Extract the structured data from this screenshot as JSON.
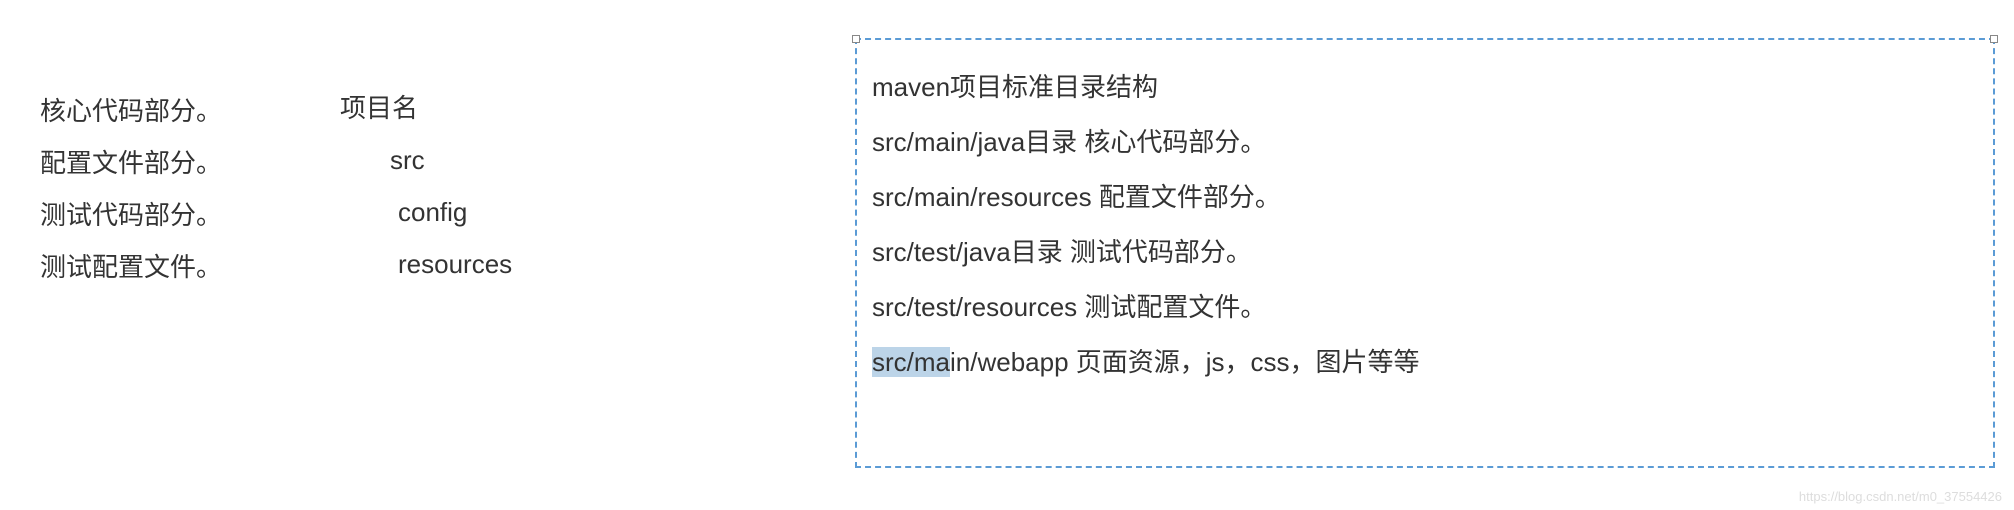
{
  "left_col1": {
    "line1": "核心代码部分。",
    "line2": "配置文件部分。",
    "line3": "测试代码部分。",
    "line4": "测试配置文件。"
  },
  "left_col2": {
    "line1": "项目名",
    "line2": "src",
    "line3": "config",
    "line4": "resources"
  },
  "right_box": {
    "line1": "maven项目标准目录结构",
    "line2": "src/main/java目录  核心代码部分。",
    "line3": "src/main/resources  配置文件部分。",
    "line4": "src/test/java目录 测试代码部分。",
    "line5": "src/test/resources 测试配置文件。",
    "line6_hl": "src/ma",
    "line6_caret": "i",
    "line6_rest": "n/webapp 页面资源，js，css，图片等等"
  },
  "watermark": "https://blog.csdn.net/m0_37554426"
}
